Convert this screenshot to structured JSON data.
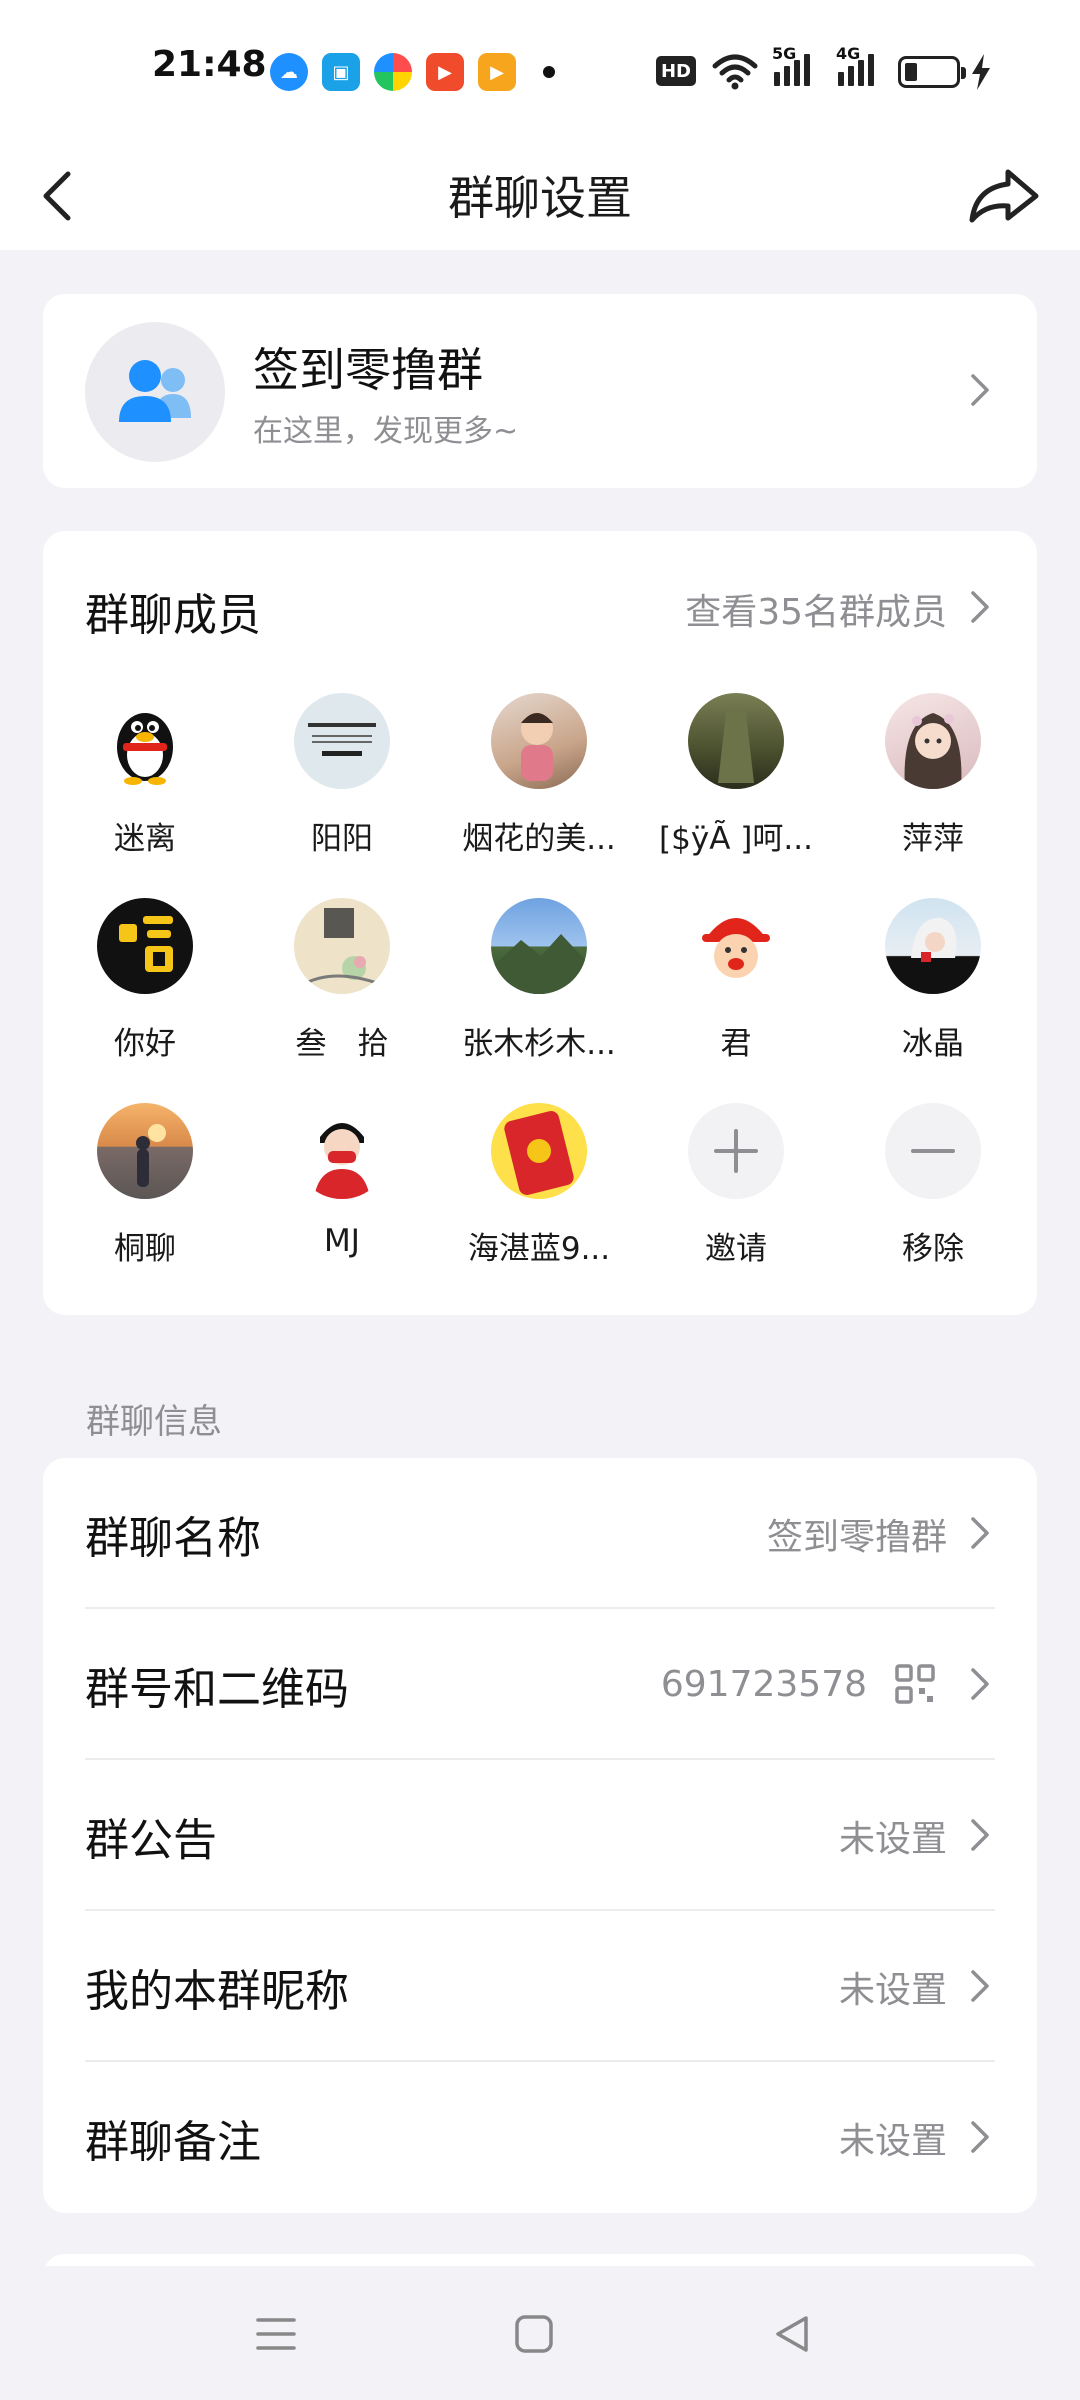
{
  "status_bar": {
    "time": "21:48",
    "apps": [
      "qq-browser-icon",
      "tab-icon",
      "pinwheel-icon",
      "video-play-icon",
      "media-play-icon"
    ],
    "hd_label": "HD",
    "signal1_label": "5G",
    "signal2_label": "4G"
  },
  "nav": {
    "title": "群聊设置"
  },
  "group": {
    "name": "签到零撸群",
    "subtitle": "在这里，发现更多~"
  },
  "members": {
    "title": "群聊成员",
    "view_all": "查看35名群成员",
    "list": [
      {
        "name": "迷离",
        "bg": "#ffffff"
      },
      {
        "name": "阳阳",
        "bg": "#dfe8ec"
      },
      {
        "name": "烟花的美...",
        "bg": "#c9a58a"
      },
      {
        "name": "[$ÿÃ ]呵...",
        "bg": "#5a5f3c"
      },
      {
        "name": "萍萍",
        "bg": "#e8d3d3"
      },
      {
        "name": "你好",
        "bg": "#111111"
      },
      {
        "name": "叁　拾",
        "bg": "#e7dcc2"
      },
      {
        "name": "张木杉木...",
        "bg": "#5a86c2"
      },
      {
        "name": "君",
        "bg": "#ffffff"
      },
      {
        "name": "冰晶",
        "bg": "#cfe3f0"
      },
      {
        "name": "桐聊",
        "bg": "#d98a4a"
      },
      {
        "name": "MJ",
        "bg": "#ffffff"
      },
      {
        "name": "海湛蓝9...",
        "bg": "#d8262a"
      }
    ],
    "invite_label": "邀请",
    "remove_label": "移除"
  },
  "info": {
    "section_title": "群聊信息",
    "rows": [
      {
        "label": "群聊名称",
        "value": "签到零撸群"
      },
      {
        "label": "群号和二维码",
        "value": "691723578"
      },
      {
        "label": "群公告",
        "value": "未设置"
      },
      {
        "label": "我的本群昵称",
        "value": "未设置"
      },
      {
        "label": "群聊备注",
        "value": "未设置"
      }
    ]
  },
  "colors": {
    "accent": "#1e90ff",
    "background": "#f2f2f7",
    "secondary_text": "#8e8e93"
  }
}
